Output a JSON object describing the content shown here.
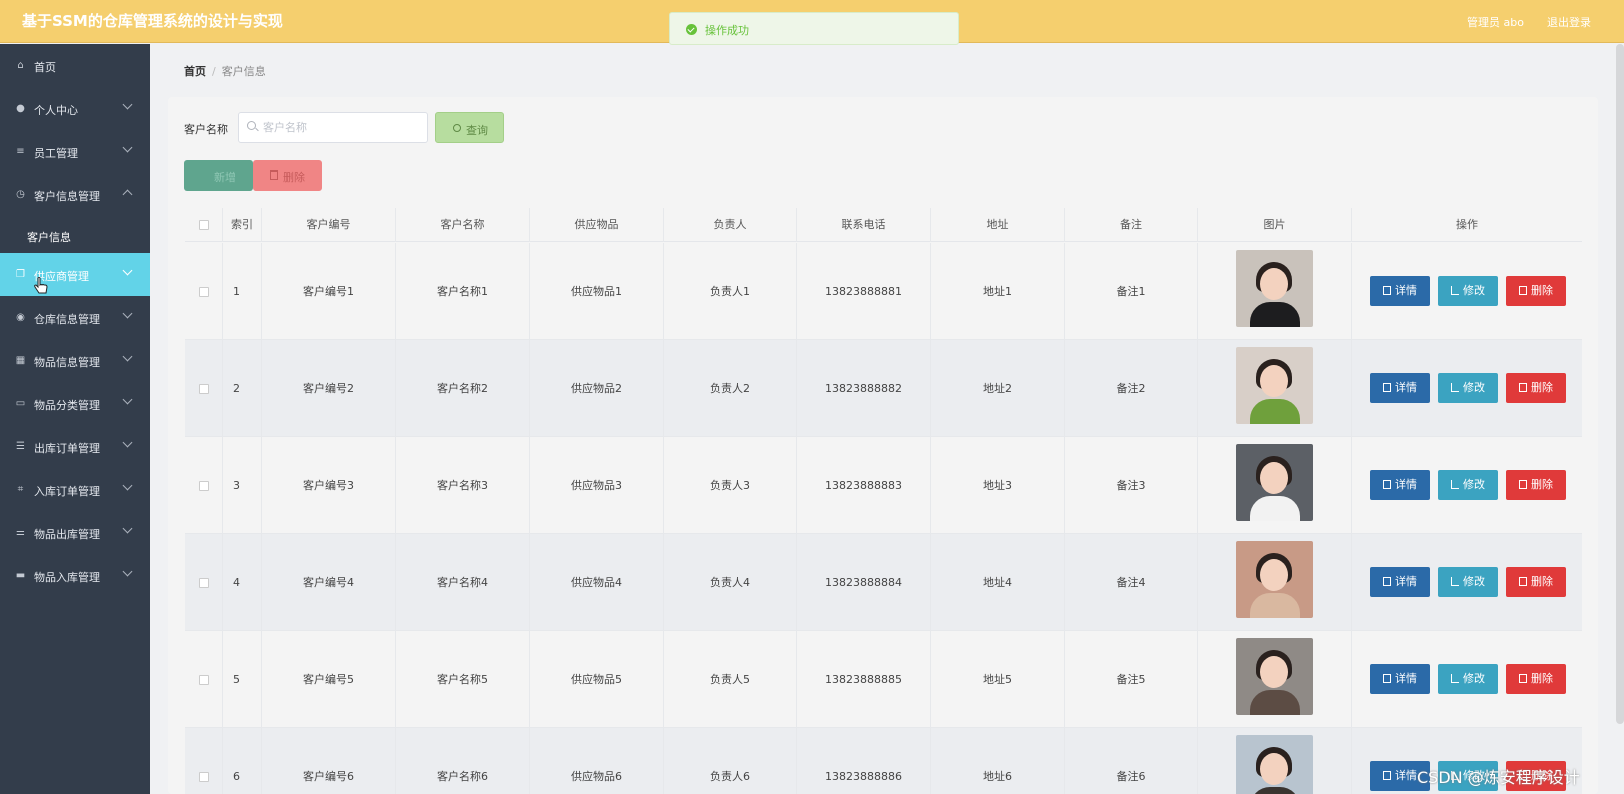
{
  "header": {
    "title": "基于SSM的仓库管理系统的设计与实现",
    "user": "管理员 abo",
    "logout": "退出登录"
  },
  "toast": {
    "message": "操作成功"
  },
  "sidebar": {
    "items": [
      {
        "label": "首页",
        "icon": "home-icon"
      },
      {
        "label": "个人中心",
        "icon": "user-icon"
      },
      {
        "label": "员工管理",
        "icon": "list-icon"
      },
      {
        "label": "客户信息管理",
        "icon": "clock-icon"
      },
      {
        "label": "客户信息",
        "icon": ""
      },
      {
        "label": "供应商管理",
        "icon": "copy-icon"
      },
      {
        "label": "仓库信息管理",
        "icon": "mic-icon"
      },
      {
        "label": "物品信息管理",
        "icon": "calendar-icon"
      },
      {
        "label": "物品分类管理",
        "icon": "briefcase-icon"
      },
      {
        "label": "出库订单管理",
        "icon": "list-icon"
      },
      {
        "label": "入库订单管理",
        "icon": "crop-icon"
      },
      {
        "label": "物品出库管理",
        "icon": "sliders-icon"
      },
      {
        "label": "物品入库管理",
        "icon": "monitor-icon"
      }
    ]
  },
  "breadcrumb": {
    "home": "首页",
    "current": "客户信息"
  },
  "search": {
    "label": "客户名称",
    "placeholder": "客户名称",
    "value": "",
    "button": "查询"
  },
  "actions": {
    "add": "新增",
    "delete": "删除"
  },
  "table": {
    "headers": [
      "索引",
      "客户编号",
      "客户名称",
      "供应物品",
      "负责人",
      "联系电话",
      "地址",
      "备注",
      "图片",
      "操作"
    ],
    "rows": [
      {
        "index": "1",
        "code": "客户编号1",
        "name": "客户名称1",
        "goods": "供应物品1",
        "manager": "负责人1",
        "phone": "13823888881",
        "address": "地址1",
        "note": "备注1"
      },
      {
        "index": "2",
        "code": "客户编号2",
        "name": "客户名称2",
        "goods": "供应物品2",
        "manager": "负责人2",
        "phone": "13823888882",
        "address": "地址2",
        "note": "备注2"
      },
      {
        "index": "3",
        "code": "客户编号3",
        "name": "客户名称3",
        "goods": "供应物品3",
        "manager": "负责人3",
        "phone": "13823888883",
        "address": "地址3",
        "note": "备注3"
      },
      {
        "index": "4",
        "code": "客户编号4",
        "name": "客户名称4",
        "goods": "供应物品4",
        "manager": "负责人4",
        "phone": "13823888884",
        "address": "地址4",
        "note": "备注4"
      },
      {
        "index": "5",
        "code": "客户编号5",
        "name": "客户名称5",
        "goods": "供应物品5",
        "manager": "负责人5",
        "phone": "13823888885",
        "address": "地址5",
        "note": "备注5"
      },
      {
        "index": "6",
        "code": "客户编号6",
        "name": "客户名称6",
        "goods": "供应物品6",
        "manager": "负责人6",
        "phone": "13823888886",
        "address": "地址6",
        "note": "备注6"
      }
    ],
    "ops": {
      "detail": "详情",
      "edit": "修改",
      "delete": "删除"
    }
  },
  "colors": {
    "header": "#f5cf6e",
    "sidebar": "#333d4b",
    "active": "#62d3e8",
    "detail": "#2b6aa8",
    "edit": "#3ba3c1",
    "delete": "#e03a3a"
  },
  "watermark": "CSDN @炼安程序设计"
}
